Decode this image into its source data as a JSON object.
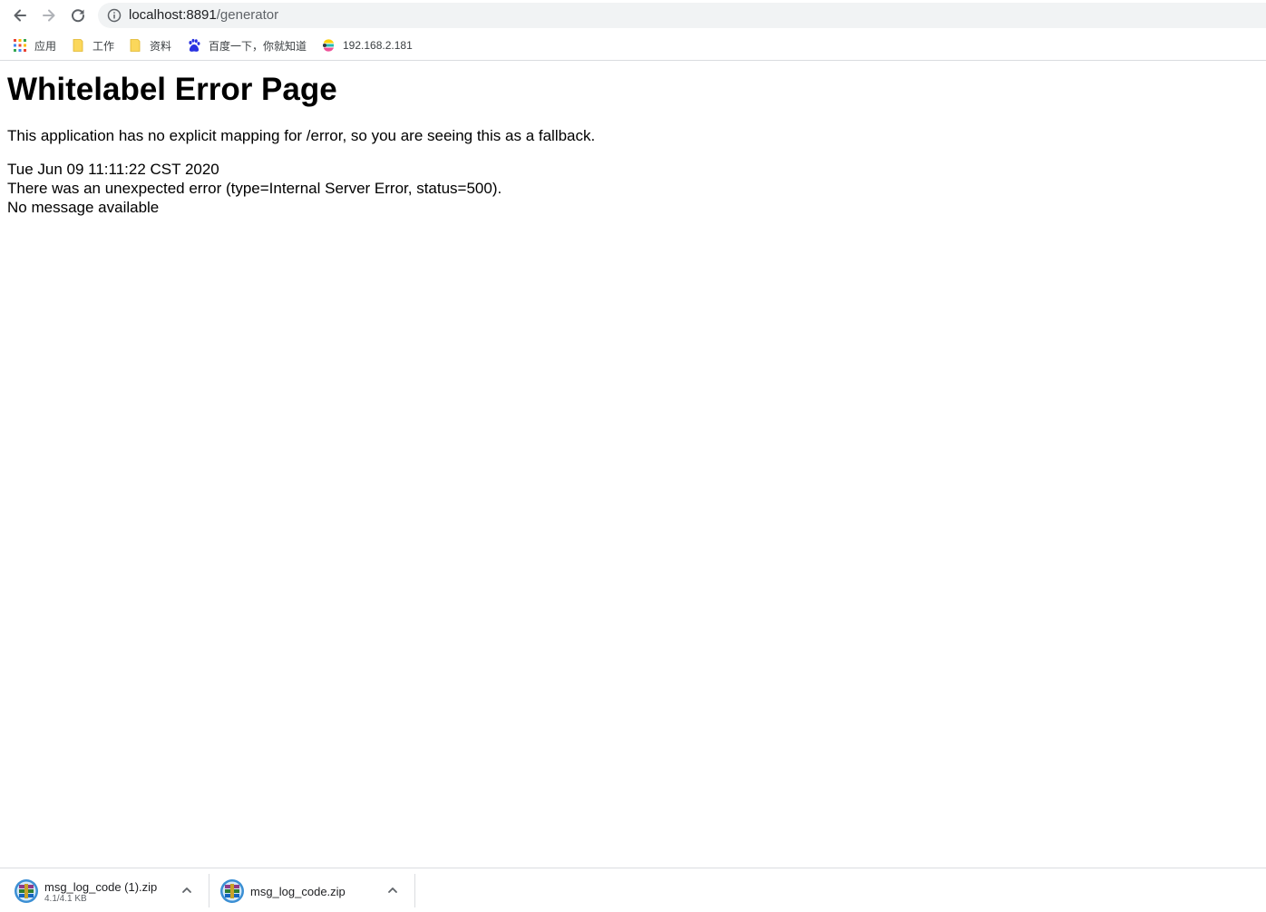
{
  "browser": {
    "url_host": "localhost:8891",
    "url_path": "/generator"
  },
  "bookmarks": [
    {
      "label": "应用",
      "icon": "apps-grid-icon"
    },
    {
      "label": "工作",
      "icon": "folder-icon"
    },
    {
      "label": "资料",
      "icon": "folder-icon"
    },
    {
      "label": "百度一下，你就知道",
      "icon": "baidu-paw-icon"
    },
    {
      "label": "192.168.2.181",
      "icon": "elastic-logo-icon"
    }
  ],
  "page": {
    "title": "Whitelabel Error Page",
    "description": "This application has no explicit mapping for /error, so you are seeing this as a fallback.",
    "timestamp": "Tue Jun 09 11:11:22 CST 2020",
    "error_line": "There was an unexpected error (type=Internal Server Error, status=500).",
    "message": "No message available"
  },
  "downloads": [
    {
      "name": "msg_log_code (1).zip",
      "size": "4.1/4.1 KB",
      "icon": "winrar-archive-icon"
    },
    {
      "name": "msg_log_code.zip",
      "size": "",
      "icon": "winrar-archive-icon"
    }
  ],
  "colors": {
    "omnibox_bg": "#f1f3f4",
    "toolbar_icon": "#5f6368",
    "folder_yellow": "#fbd75b",
    "baidu_blue": "#2932e1"
  }
}
